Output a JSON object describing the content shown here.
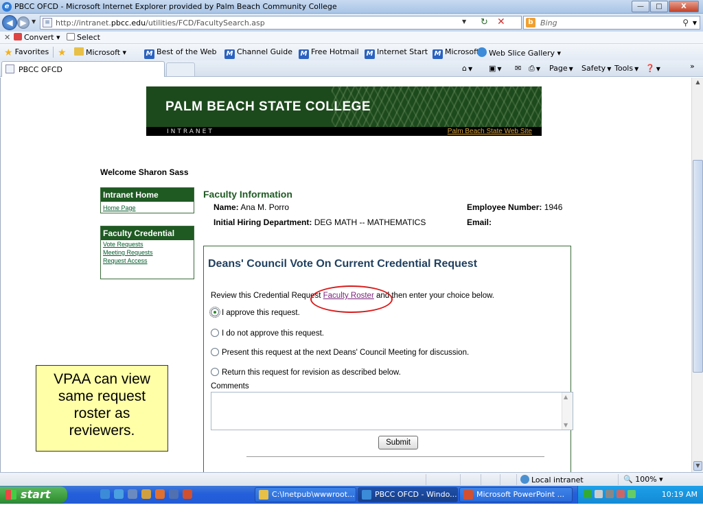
{
  "window": {
    "title": "PBCC OFCD - Microsoft Internet Explorer provided by Palm Beach Community College",
    "minimize": "—",
    "maximize": "□",
    "close": "X"
  },
  "address": {
    "url_prefix": "http://intranet.",
    "url_domain": "pbcc.edu",
    "url_rest": "/utilities/FCD/FacultySearch.asp",
    "search_placeholder": "Bing"
  },
  "command_bar": {
    "convert": "Convert",
    "select": "Select"
  },
  "favorites_bar": {
    "favorites": "Favorites",
    "items": [
      "Microsoft",
      "Best of the Web",
      "Channel Guide",
      "Free Hotmail",
      "Internet Start",
      "Microsoft",
      "Web Slice Gallery"
    ]
  },
  "tab": {
    "label": "PBCC OFCD"
  },
  "toolbar": {
    "page": "Page",
    "safety": "Safety",
    "tools": "Tools"
  },
  "banner": {
    "college": "PALM BEACH STATE COLLEGE",
    "intranet": "INTRANET",
    "site_link": "Palm Beach State Web Site"
  },
  "welcome": "Welcome Sharon Sass",
  "sidebar": {
    "intranet_home": {
      "heading": "Intranet Home",
      "links": [
        "Home Page"
      ]
    },
    "faculty_credential": {
      "heading": "Faculty Credential",
      "links": [
        "Vote Requests",
        "Meeting Requests",
        "Request Access"
      ]
    }
  },
  "faculty": {
    "heading": "Faculty Information",
    "name_label": "Name:",
    "name_value": "Ana M. Porro",
    "dept_label": "Initial Hiring Department:",
    "dept_value": "DEG MATH -- MATHEMATICS",
    "employee_label": "Employee Number:",
    "employee_value": "1946",
    "email_label": "Email:",
    "email_value": ""
  },
  "vote": {
    "title": "Deans' Council Vote On Current Credential Request",
    "review_before": "Review this Credential Request ",
    "review_link": "Faculty Roster",
    "review_after": " and then enter your choice below.",
    "options": [
      {
        "label": "I approve this request.",
        "selected": true
      },
      {
        "label": "I do not approve this request.",
        "selected": false
      },
      {
        "label": "Present this request at the next Deans' Council Meeting for discussion.",
        "selected": false
      },
      {
        "label": "Return this request for revision as described below.",
        "selected": false
      }
    ],
    "comments_label": "Comments",
    "comments_value": "",
    "submit": "Submit"
  },
  "callout": {
    "lines": [
      "VPAA can view",
      "same request",
      "roster as",
      "reviewers."
    ]
  },
  "status": {
    "zone": "Local intranet",
    "zoom": "100%"
  },
  "taskbar": {
    "start": "start",
    "tasks": [
      "C:\\Inetpub\\wwwroot...",
      "PBCC OFCD - Windo...",
      "Microsoft PowerPoint ..."
    ],
    "clock": "10:19 AM"
  }
}
